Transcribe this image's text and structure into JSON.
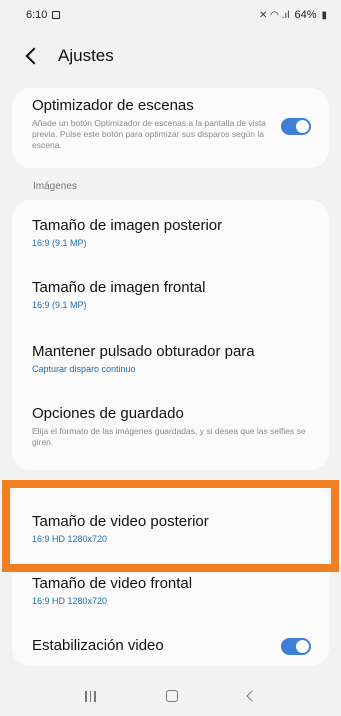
{
  "status_bar": {
    "time": "6:10",
    "signal_icons": "✕ ◠ .ıl",
    "battery": "64%"
  },
  "header": {
    "title": "Ajustes"
  },
  "scene_optimizer": {
    "title": "Optimizador de escenas",
    "description": "Añade un botón Optimizador de escenas a la pantalla de vista previa. Pulse este botón para optimizar sus disparos según la escena.",
    "enabled": true
  },
  "images_section": {
    "label": "Imágenes",
    "items": [
      {
        "title": "Tamaño de imagen posterior",
        "value": "16:9 (9.1 MP)"
      },
      {
        "title": "Tamaño de imagen frontal",
        "value": "16:9 (9.1 MP)"
      },
      {
        "title": "Mantener pulsado obturador para",
        "value": "Capturar disparo continuo"
      },
      {
        "title": "Opciones de guardado",
        "description": "Elija el formato de las imágenes guardadas, y si desea que las selfies se giren."
      }
    ]
  },
  "video_section": {
    "items": [
      {
        "title": "Tamaño de video posterior",
        "value": "16:9 HD 1280x720"
      },
      {
        "title": "Tamaño de video frontal",
        "value": "16:9 HD 1280x720"
      },
      {
        "title": "Estabilización video",
        "enabled": true
      }
    ]
  },
  "colors": {
    "accent": "#3d7fd6",
    "value_text": "#1f6fb5",
    "highlight": "#f07f24"
  },
  "icons": {
    "back": "back-chevron-icon",
    "nav_recents": "recents-icon",
    "nav_home": "home-icon",
    "nav_back": "nav-back-icon"
  }
}
